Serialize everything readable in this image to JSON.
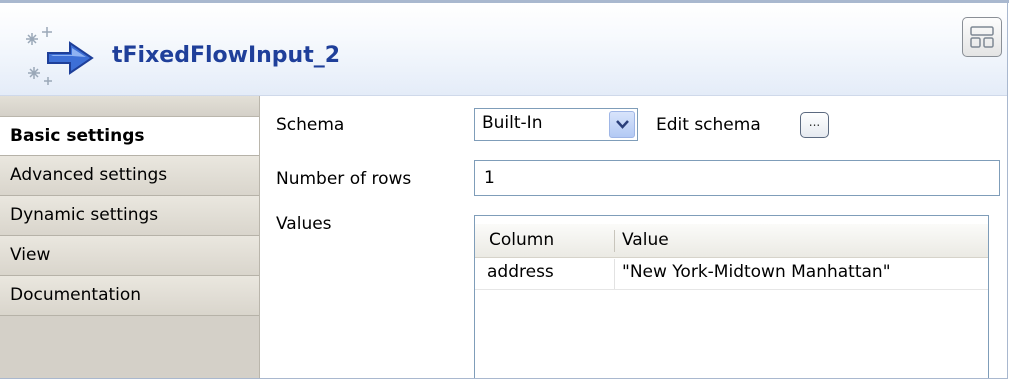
{
  "header": {
    "title": "tFixedFlowInput_2"
  },
  "tabs": [
    {
      "label": "Basic settings",
      "active": true
    },
    {
      "label": "Advanced settings",
      "active": false
    },
    {
      "label": "Dynamic settings",
      "active": false
    },
    {
      "label": "View",
      "active": false
    },
    {
      "label": "Documentation",
      "active": false
    }
  ],
  "form": {
    "schema_label": "Schema",
    "schema_value": "Built-In",
    "edit_schema_label": "Edit schema",
    "edit_schema_button": "...",
    "rows_label": "Number of rows",
    "rows_value": "1",
    "values_label": "Values"
  },
  "values_table": {
    "columns": [
      "Column",
      "Value"
    ],
    "rows": [
      {
        "column": "address",
        "value": "\"New York-Midtown Manhattan\""
      }
    ]
  },
  "colors": {
    "title": "#1f3f9a",
    "header_gradient_end": "#e4ecf8",
    "sidebar": "#d4d0c8"
  }
}
